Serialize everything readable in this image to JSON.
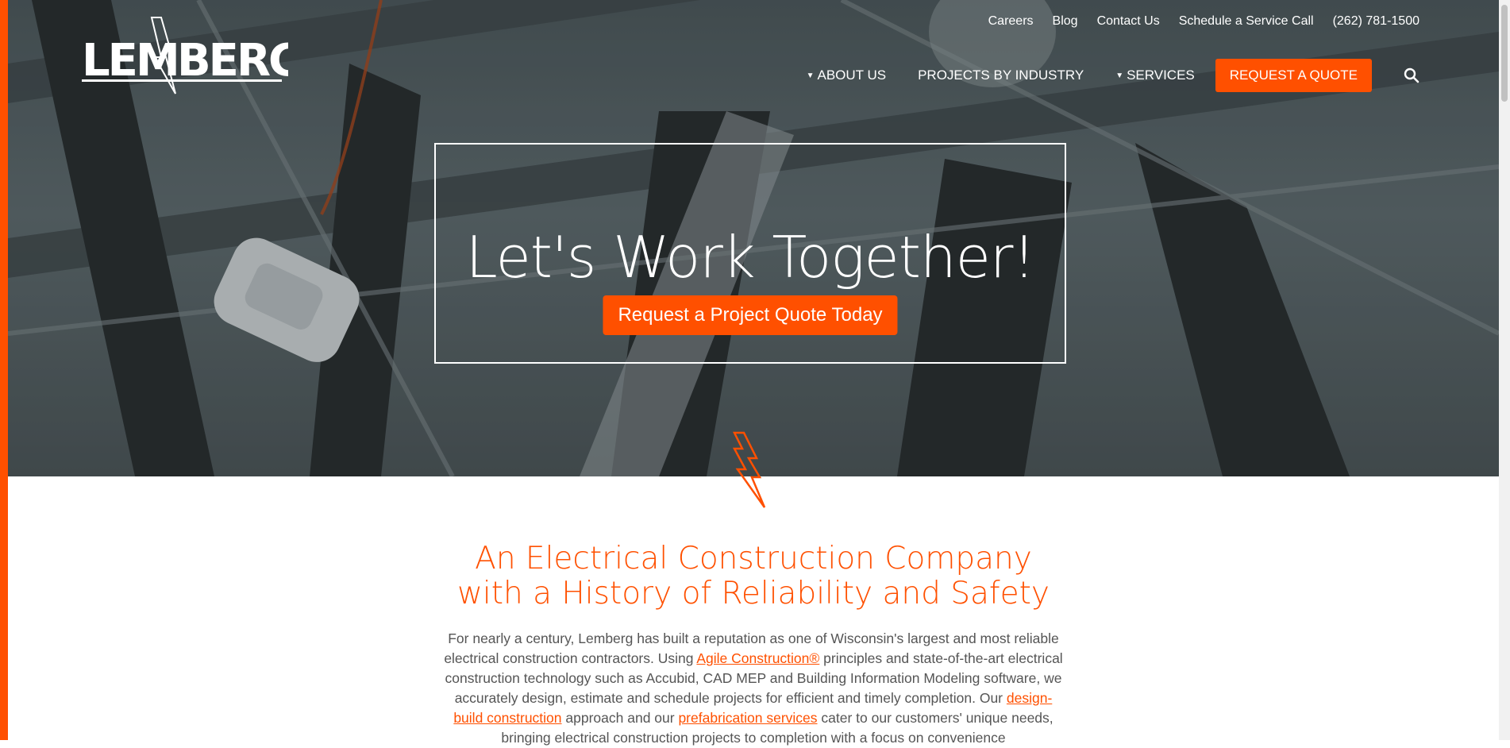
{
  "brand": {
    "name": "LEMBERG",
    "accent_color": "#ff5000"
  },
  "utility_nav": {
    "careers": "Careers",
    "blog": "Blog",
    "contact": "Contact Us",
    "service_call": "Schedule a Service Call",
    "phone": "(262) 781-1500"
  },
  "main_nav": {
    "about": "ABOUT US",
    "projects": "PROJECTS BY INDUSTRY",
    "services": "SERVICES",
    "request_quote": "REQUEST A QUOTE",
    "caret": "▼"
  },
  "hero": {
    "title": "Let's Work Together!",
    "cta": "Request a Project Quote Today"
  },
  "section": {
    "title_line1": "An Electrical Construction Company",
    "title_line2": "with a History of Reliability and Safety",
    "p1": "For nearly a century, Lemberg has built a reputation as one of Wisconsin's largest and most reliable electrical construction contractors. Using ",
    "link1": "Agile Construction®",
    "p2": " principles and state-of-the-art electrical construction technology such as Accubid, CAD MEP and Building Information Modeling software, we accurately design, estimate and schedule projects for efficient and timely completion. Our ",
    "link2": "design-build construction",
    "p3": " approach and our ",
    "link3": "prefabrication services",
    "p4": " cater to our customers' unique needs, bringing electrical construction projects to completion with a focus on convenience"
  }
}
